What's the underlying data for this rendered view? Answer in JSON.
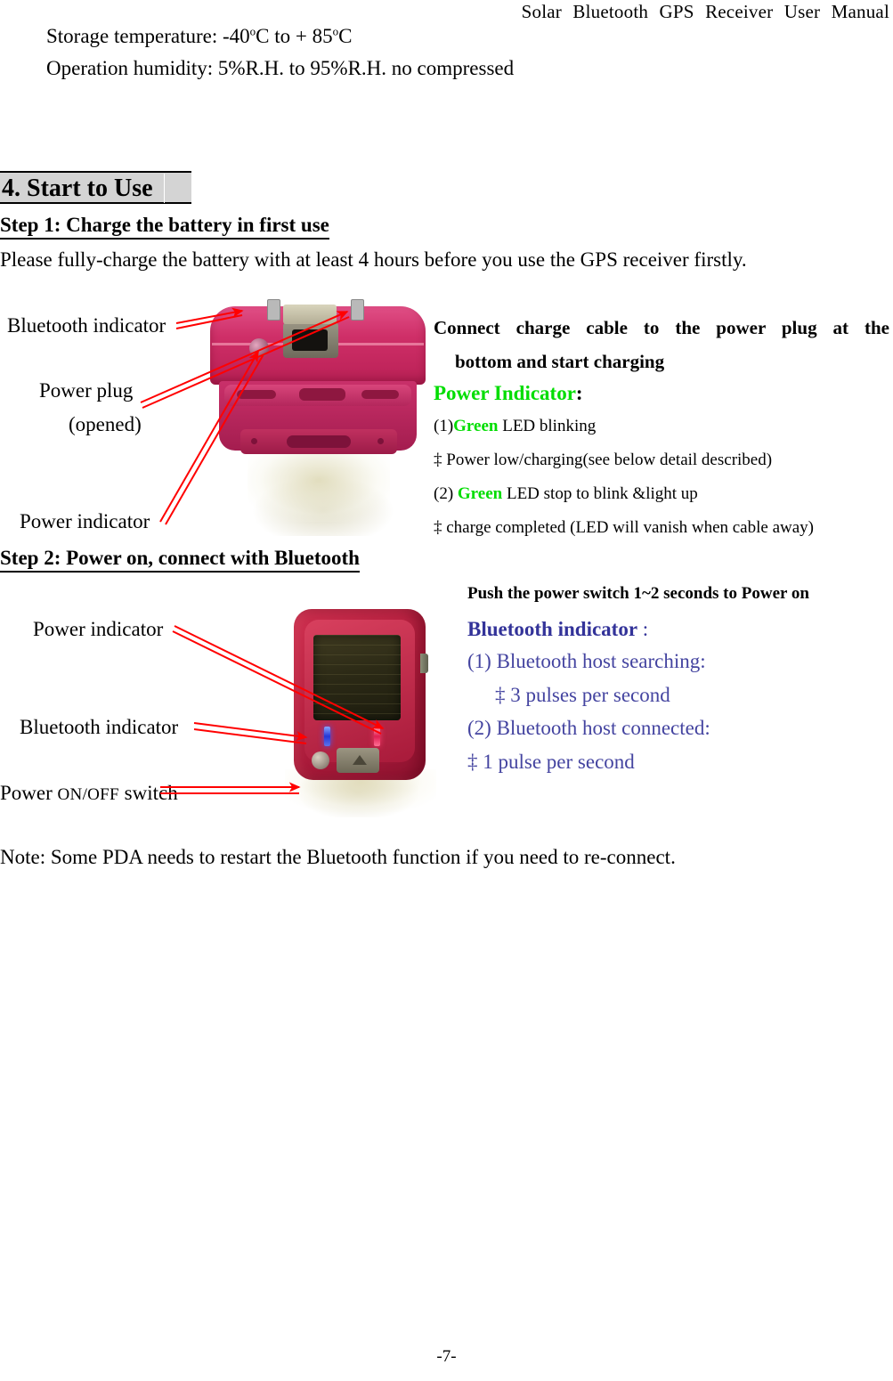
{
  "header": {
    "running_title": "Solar  Bluetooth  GPS  Receiver  User  Manual"
  },
  "specs": [
    {
      "label": "Storage temperature: -40",
      "sup1": "o",
      "mid": "C to + 85",
      "sup2": "o",
      "tail": "C"
    },
    {
      "text": "Operation humidity: 5%R.H. to 95%R.H. no compressed"
    }
  ],
  "section": {
    "number_title": "4. Start to Use"
  },
  "step1": {
    "heading": "Step 1: Charge the battery in first use",
    "intro": "Please fully-charge the battery with at least 4 hours before you use the GPS receiver firstly.",
    "callouts": [
      {
        "name": "bluetooth-indicator",
        "text": "Bluetooth indicator"
      },
      {
        "name": "power-plug",
        "text": "Power plug"
      },
      {
        "name": "power-plug-opened",
        "text": "(opened)"
      },
      {
        "name": "power-indicator",
        "text": "Power indicator"
      }
    ],
    "instructions": {
      "connect_line": "Connect charge cable to the power plug at the",
      "connect_line2": "bottom and start charging",
      "power_indicator_label": "Power Indicator",
      "power_indicator_colon": ":",
      "item1_prefix": "(1)",
      "item1_green": "Green",
      "item1_rest": " LED blinking",
      "item1_sub": "‡  Power low/charging(see below    detail described)",
      "item2_prefix": "(2) ",
      "item2_green": "Green",
      "item2_rest": " LED stop to blink &light up",
      "item2_sub": "‡  charge completed (LED will vanish when cable away)"
    }
  },
  "step2": {
    "heading": "Step 2: Power on, connect with Bluetooth",
    "callouts": [
      {
        "name": "power-indicator",
        "text": "Power indicator"
      },
      {
        "name": "bluetooth-indicator",
        "text": "Bluetooth indicator"
      },
      {
        "name": "power-onoff-switch-prefix",
        "text": "Power "
      },
      {
        "name": "power-onoff-switch-caps",
        "text": "ON/OFF"
      },
      {
        "name": "power-onoff-switch-suffix",
        "text": " switch"
      }
    ],
    "instructions": {
      "push_line": "Push the power switch 1~2 seconds to Power on",
      "bt_label": "Bluetooth indicator",
      "bt_colon": " :",
      "item1": "(1) Bluetooth host searching:",
      "item1_sub": "‡  3 pulses per second",
      "item2": "(2) Bluetooth    host connected:",
      "item2_sub": "‡  1 pulse per second"
    }
  },
  "note": {
    "text": "Note: Some PDA needs to restart the Bluetooth function if you need to re-connect."
  },
  "footer": {
    "page_number": "-7-"
  },
  "colors": {
    "green_accent": "#00dd00",
    "bluetooth_blue": "#333399",
    "bluetooth_body_blue": "#4444a0",
    "arrow_red": "#ff0000",
    "heading_shade": "#d4d4d4"
  }
}
